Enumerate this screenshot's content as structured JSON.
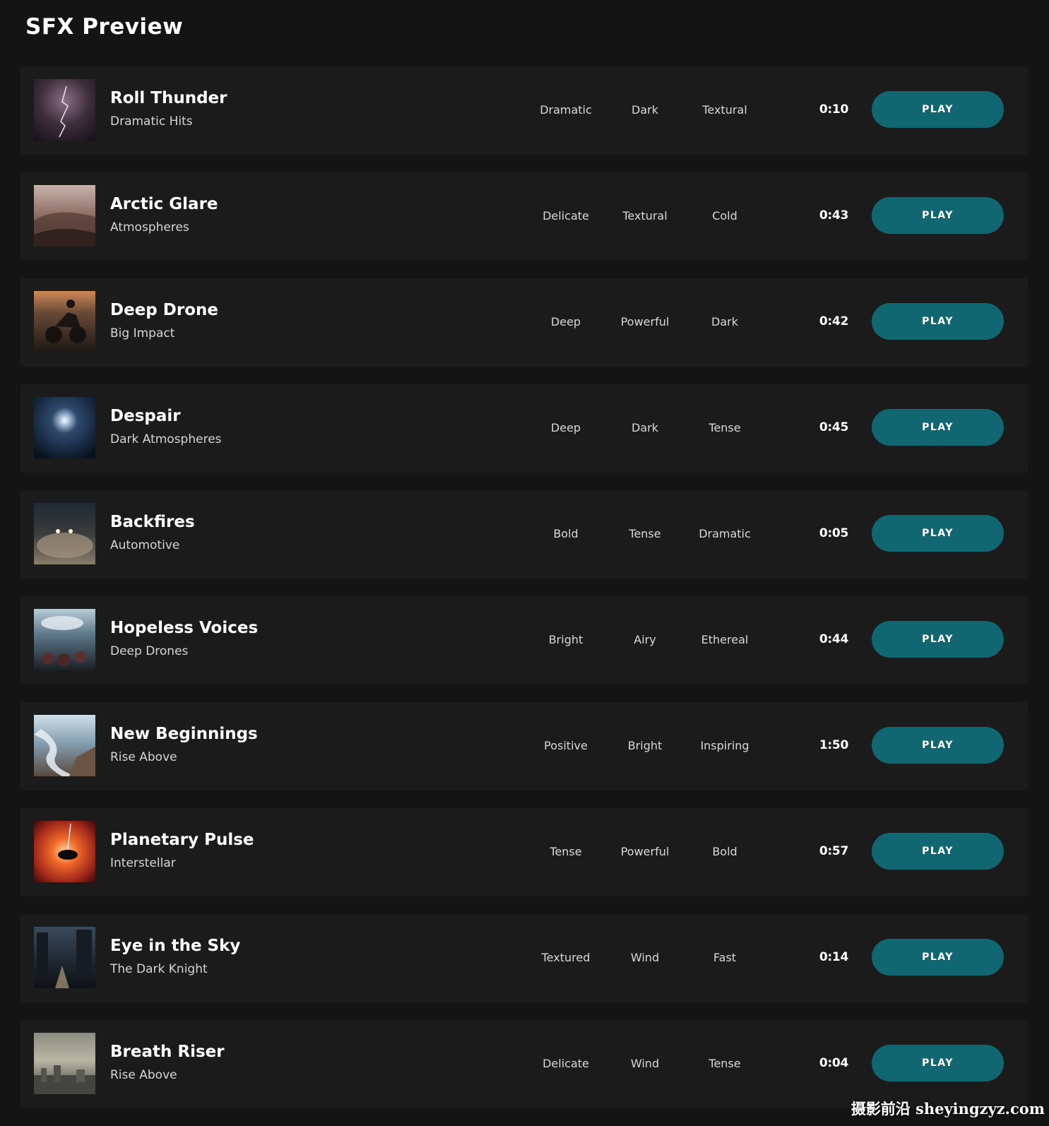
{
  "page": {
    "title": "SFX Preview"
  },
  "tracks": [
    {
      "title": "Roll Thunder",
      "subtitle": "Dramatic Hits",
      "tags": [
        "Dramatic",
        "Dark",
        "Textural"
      ],
      "duration": "0:10",
      "play_label": "PLAY"
    },
    {
      "title": "Arctic Glare",
      "subtitle": "Atmospheres",
      "tags": [
        "Delicate",
        "Textural",
        "Cold"
      ],
      "duration": "0:43",
      "play_label": "PLAY"
    },
    {
      "title": "Deep Drone",
      "subtitle": "Big Impact",
      "tags": [
        "Deep",
        "Powerful",
        "Dark"
      ],
      "duration": "0:42",
      "play_label": "PLAY"
    },
    {
      "title": "Despair",
      "subtitle": "Dark Atmospheres",
      "tags": [
        "Deep",
        "Dark",
        "Tense"
      ],
      "duration": "0:45",
      "play_label": "PLAY"
    },
    {
      "title": "Backfires",
      "subtitle": "Automotive",
      "tags": [
        "Bold",
        "Tense",
        "Dramatic"
      ],
      "duration": "0:05",
      "play_label": "PLAY"
    },
    {
      "title": "Hopeless Voices",
      "subtitle": "Deep Drones",
      "tags": [
        "Bright",
        "Airy",
        "Ethereal"
      ],
      "duration": "0:44",
      "play_label": "PLAY"
    },
    {
      "title": "New Beginnings",
      "subtitle": "Rise Above",
      "tags": [
        "Positive",
        "Bright",
        "Inspiring"
      ],
      "duration": "1:50",
      "play_label": "PLAY"
    },
    {
      "title": "Planetary Pulse",
      "subtitle": "Interstellar",
      "tags": [
        "Tense",
        "Powerful",
        "Bold"
      ],
      "duration": "0:57",
      "play_label": "PLAY"
    },
    {
      "title": "Eye in the Sky",
      "subtitle": "The Dark Knight",
      "tags": [
        "Textured",
        "Wind",
        "Fast"
      ],
      "duration": "0:14",
      "play_label": "PLAY"
    },
    {
      "title": "Breath Riser",
      "subtitle": "Rise Above",
      "tags": [
        "Delicate",
        "Wind",
        "Tense"
      ],
      "duration": "0:04",
      "play_label": "PLAY"
    }
  ],
  "theme": {
    "background": "#141414",
    "row_background": "#1b1b1b",
    "button_color": "#116771",
    "text_primary": "#ffffff",
    "text_secondary": "#d6d6d6"
  },
  "watermark": "摄影前沿 sheyingzyz.com"
}
